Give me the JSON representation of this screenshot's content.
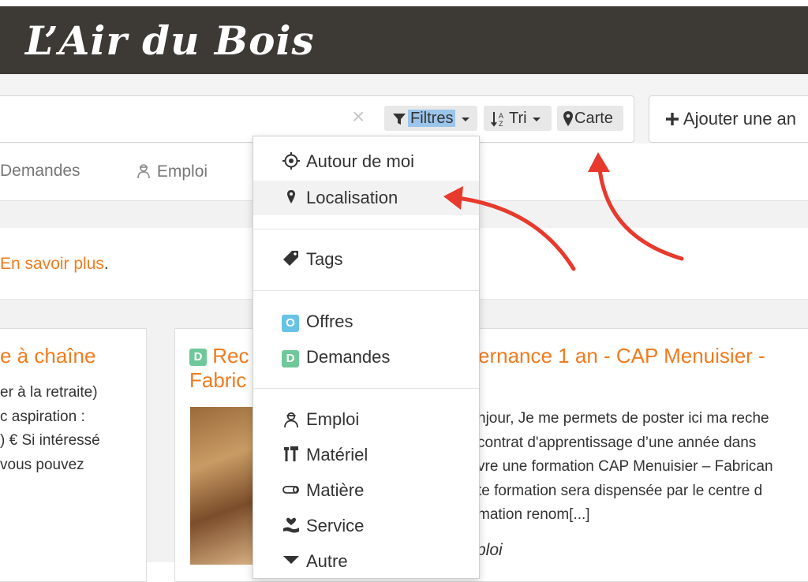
{
  "brand": {
    "title": "L’Air du Bois"
  },
  "toolbar": {
    "clear_icon": "×",
    "filters_label": "Filtres",
    "sort_label": "Tri",
    "map_label": "Carte",
    "add_label": "Ajouter une an"
  },
  "tabs": [
    {
      "label": "Demandes"
    },
    {
      "label": "Emploi",
      "icon": "worker-icon"
    }
  ],
  "info": {
    "link_text": "En savoir plus",
    "suffix": "."
  },
  "left_card": {
    "title": "e à chaîne",
    "lines": [
      "er à la retraite)",
      "c aspiration :",
      ") € Si intéressé",
      "vous pouvez"
    ]
  },
  "main_card": {
    "badge": "D",
    "title_line1_start": "Rec",
    "title_line1_end": "ernance 1 an - CAP Menuisier -",
    "title_line2": "Fabric",
    "lines": [
      "njour, Je me permets de poster ici ma reche",
      "contrat d'apprentissage d’une année dans",
      "vre une formation CAP Menuisier – Fabrican",
      "te formation sera dispensée par le centre d",
      "mation renom[...]"
    ],
    "meta": "ploi"
  },
  "dropdown": {
    "items": [
      {
        "label": "Autour de moi",
        "icon": "crosshair-icon"
      },
      {
        "label": "Localisation",
        "icon": "map-marker-icon"
      },
      {
        "label": "Tags",
        "icon": "tag-icon"
      },
      {
        "label": "Offres",
        "icon": "offer-badge",
        "badge": "O"
      },
      {
        "label": "Demandes",
        "icon": "request-badge",
        "badge": "D"
      },
      {
        "label": "Emploi",
        "icon": "worker-icon"
      },
      {
        "label": "Matériel",
        "icon": "tools-icon"
      },
      {
        "label": "Matière",
        "icon": "wood-log-icon"
      },
      {
        "label": "Service",
        "icon": "hand-heart-icon"
      },
      {
        "label": "Autre",
        "icon": "arrow-down-icon"
      }
    ]
  },
  "colors": {
    "header_bg": "#3d3a36",
    "accent_orange": "#f07b1e",
    "annotation_red": "#e8392d",
    "filter_highlight": "#9cc5eb"
  }
}
